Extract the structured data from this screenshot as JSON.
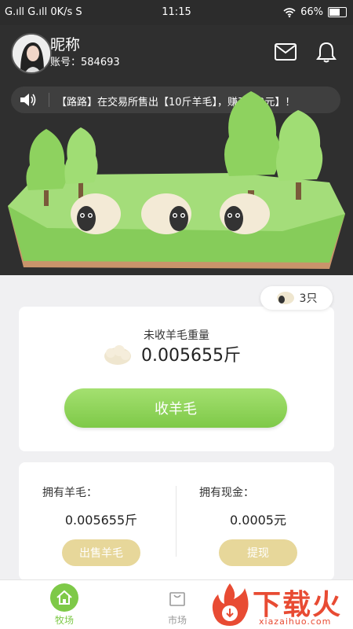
{
  "status_bar": {
    "left": "G.ıll G.ıll 0K/s S",
    "time": "11:15",
    "battery": "66%"
  },
  "user": {
    "nickname": "昵称",
    "account_label": "账号：584693"
  },
  "header_icons": [
    "mail-icon",
    "bell-icon"
  ],
  "notice": {
    "text": "【路路】在交易所售出【10斤羊毛】，赚了【2元】！"
  },
  "sheep": {
    "count_label": "3只"
  },
  "wool_card": {
    "label": "未收羊毛重量",
    "value": "0.005655斤",
    "button": "收羊毛"
  },
  "assets": {
    "wool_title": "拥有羊毛：",
    "wool_value": "0.005655斤",
    "sell_button": "出售羊毛",
    "cash_title": "拥有现金：",
    "cash_value": "0.0005元",
    "withdraw_button": "提现"
  },
  "nav": {
    "home": "牧场",
    "market": "市场"
  },
  "watermark": {
    "title": "下载火",
    "url": "xiazaihuo.com"
  },
  "colors": {
    "accent_green": "#7ec948",
    "gold": "#e7d79a",
    "dark_bg": "#2f2f2f",
    "watermark_red": "#e84b33"
  }
}
